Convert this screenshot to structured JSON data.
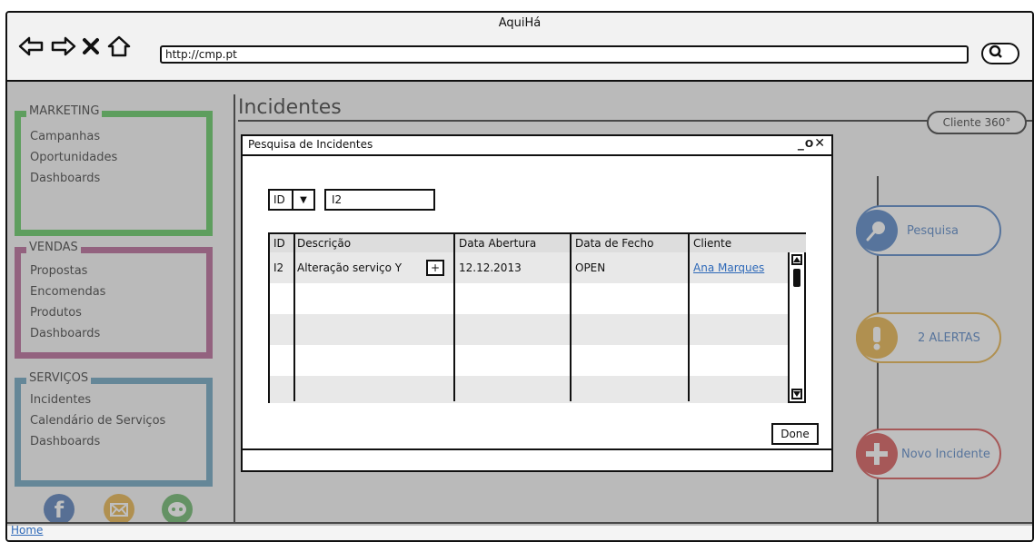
{
  "app": {
    "title": "AquiHá",
    "url": "http://cmp.pt"
  },
  "icons": {
    "back": "arrow-left-icon",
    "forward": "arrow-right-icon",
    "stop": "close-icon",
    "home": "home-icon",
    "search": "search-icon"
  },
  "sidebar": {
    "groups": [
      {
        "title": "MARKETING",
        "items": [
          "Campanhas",
          "Oportunidades",
          "Dashboards"
        ],
        "color": "#3dbd3d"
      },
      {
        "title": "VENDAS",
        "items": [
          "Propostas",
          "Encomendas",
          "Produtos",
          "Dashboards"
        ],
        "color": "#a6457e"
      },
      {
        "title": "SERVIÇOS",
        "items": [
          "Incidentes",
          "Calendário de Serviços",
          "Dashboards"
        ],
        "color": "#4b8fb0"
      }
    ],
    "social": [
      "facebook-icon",
      "email-icon",
      "chat-icon"
    ]
  },
  "main": {
    "title": "Incidentes",
    "client_button": "Cliente 360°"
  },
  "actions": {
    "search": {
      "label": "Pesquisa",
      "color": "#2e69b8"
    },
    "alerts": {
      "label": "2 ALERTAS",
      "color": "#e0a020"
    },
    "new_incident": {
      "label": "Novo Incidente",
      "color": "#cc3030"
    }
  },
  "dialog": {
    "title": "Pesquisa de Incidentes",
    "controls": "_□X",
    "field_select": "ID",
    "search_value": "I2",
    "table": {
      "columns": [
        "ID",
        "Descrição",
        "Data Abertura",
        "Data de Fecho",
        "Cliente"
      ],
      "rows": [
        {
          "id": "I2",
          "descricao": "Alteração serviço Y",
          "expand": "+",
          "data_abertura": "12.12.2013",
          "data_fecho": "OPEN",
          "cliente": "Ana Marques"
        }
      ]
    },
    "done_button": "Done"
  },
  "status": {
    "home_link": "Home"
  }
}
